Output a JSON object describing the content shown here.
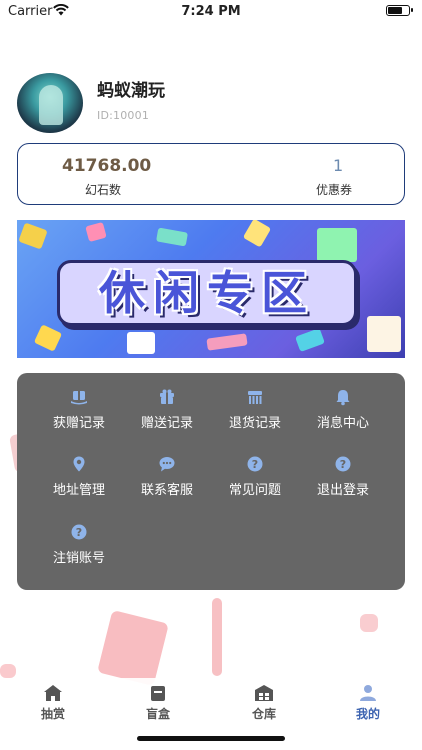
{
  "status_bar": {
    "carrier": "Carrier",
    "time": "7:24 PM"
  },
  "profile": {
    "username": "蚂蚁潮玩",
    "user_id": "ID:10001"
  },
  "stats": {
    "balance_value": "41768.00",
    "balance_label": "幻石数",
    "coupon_value": "1",
    "coupon_label": "优惠券"
  },
  "banner": {
    "title": "休闲专区"
  },
  "menu": {
    "items": [
      {
        "label": "获赠记录",
        "icon": "gift-received-icon"
      },
      {
        "label": "赠送记录",
        "icon": "gift-box-icon"
      },
      {
        "label": "退货记录",
        "icon": "return-icon"
      },
      {
        "label": "消息中心",
        "icon": "bell-icon"
      },
      {
        "label": "地址管理",
        "icon": "location-pin-icon"
      },
      {
        "label": "联系客服",
        "icon": "chat-bubble-icon"
      },
      {
        "label": "常见问题",
        "icon": "question-icon"
      },
      {
        "label": "退出登录",
        "icon": "question-icon"
      },
      {
        "label": "注销账号",
        "icon": "question-icon"
      }
    ]
  },
  "tab_bar": {
    "tabs": [
      {
        "label": "抽赏",
        "icon": "home-icon"
      },
      {
        "label": "盲盒",
        "icon": "box-icon"
      },
      {
        "label": "仓库",
        "icon": "warehouse-icon"
      },
      {
        "label": "我的",
        "icon": "user-icon",
        "active": true
      }
    ]
  },
  "colors": {
    "card_border": "#1f3c7a",
    "balance_text": "#6e5b45",
    "menu_bg": "#666666",
    "menu_icon": "#8fb4ea",
    "tab_active": "#3c63b0"
  }
}
